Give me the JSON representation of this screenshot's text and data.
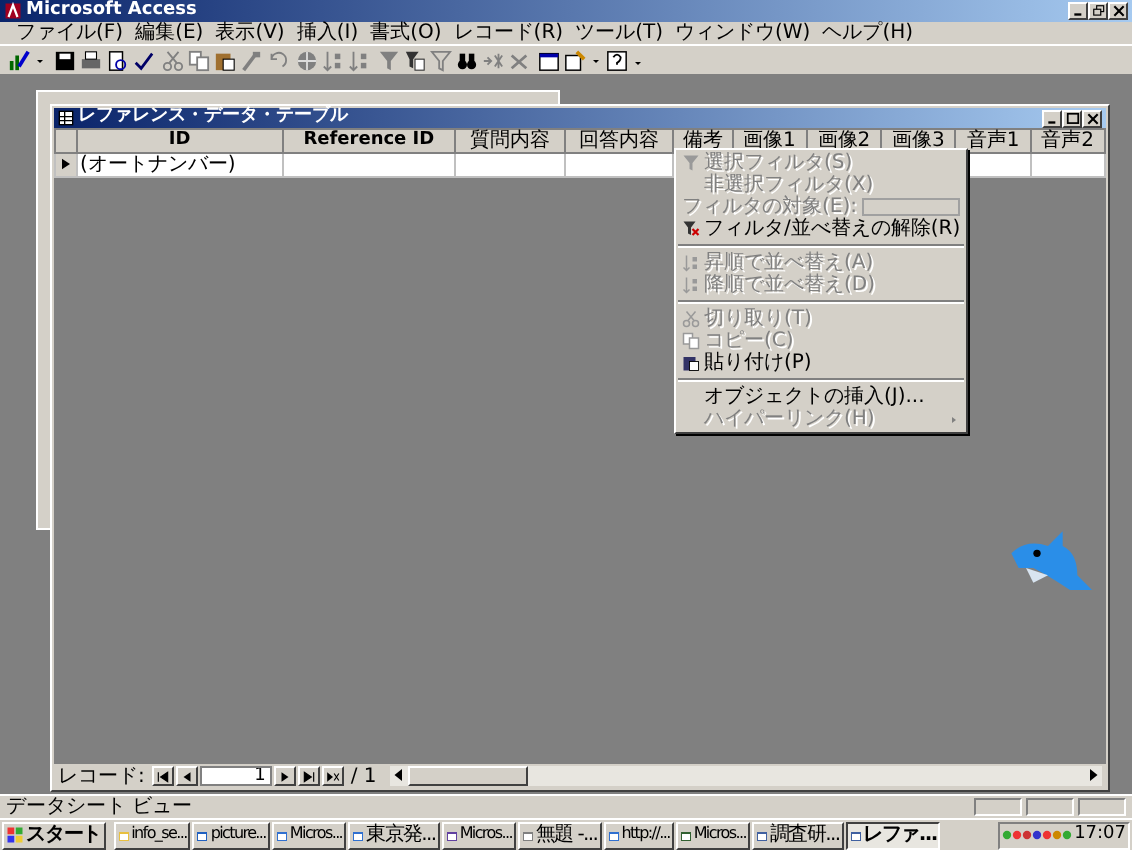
{
  "window": {
    "title": "Microsoft Access"
  },
  "menu_bar": [
    "ファイル(F)",
    "編集(E)",
    "表示(V)",
    "挿入(I)",
    "書式(O)",
    "レコード(R)",
    "ツール(T)",
    "ウィンドウ(W)",
    "ヘルプ(H)"
  ],
  "table_window": {
    "title": "レファレンス・データ・テーブル"
  },
  "columns": [
    "ID",
    "Reference ID",
    "質問内容",
    "回答内容",
    "備考",
    "画像1",
    "画像2",
    "画像3",
    "音声1",
    "音声2"
  ],
  "rows": [
    {
      "current": true,
      "id": "(オートナンバー)"
    }
  ],
  "context_menu": [
    {
      "kind": "item",
      "label": "選択フィルタ(S)",
      "disabled": true
    },
    {
      "kind": "item",
      "label": "非選択フィルタ(X)",
      "disabled": true
    },
    {
      "kind": "field",
      "label": "フィルタの対象(E):",
      "disabled": true
    },
    {
      "kind": "item",
      "label": "フィルタ/並べ替えの解除(R)",
      "disabled": false
    },
    {
      "kind": "separator"
    },
    {
      "kind": "item",
      "label": "昇順で並べ替え(A)",
      "disabled": true
    },
    {
      "kind": "item",
      "label": "降順で並べ替え(D)",
      "disabled": true
    },
    {
      "kind": "separator"
    },
    {
      "kind": "item",
      "label": "切り取り(T)",
      "disabled": true
    },
    {
      "kind": "item",
      "label": "コピー(C)",
      "disabled": true
    },
    {
      "kind": "item",
      "label": "貼り付け(P)",
      "disabled": false
    },
    {
      "kind": "separator"
    },
    {
      "kind": "item",
      "label": "オブジェクトの挿入(J)...",
      "disabled": false
    },
    {
      "kind": "submenu",
      "label": "ハイパーリンク(H)",
      "disabled": true
    }
  ],
  "record_nav": {
    "label": "レコード:",
    "current": "1",
    "total": "/ 1"
  },
  "status_bar": {
    "text": "データシート ビュー"
  },
  "taskbar": {
    "start": "スタート",
    "buttons": [
      {
        "label": "info_se...",
        "selected": false
      },
      {
        "label": "picture...",
        "selected": false
      },
      {
        "label": "Micros...",
        "selected": false
      },
      {
        "label": "東京発...",
        "selected": false
      },
      {
        "label": "Micros...",
        "selected": false
      },
      {
        "label": "無題 -...",
        "selected": false
      },
      {
        "label": "http://...",
        "selected": false
      },
      {
        "label": "Micros...",
        "selected": false
      },
      {
        "label": "調査研...",
        "selected": false
      },
      {
        "label": "レファ...",
        "selected": true
      }
    ],
    "clock": "17:07"
  }
}
